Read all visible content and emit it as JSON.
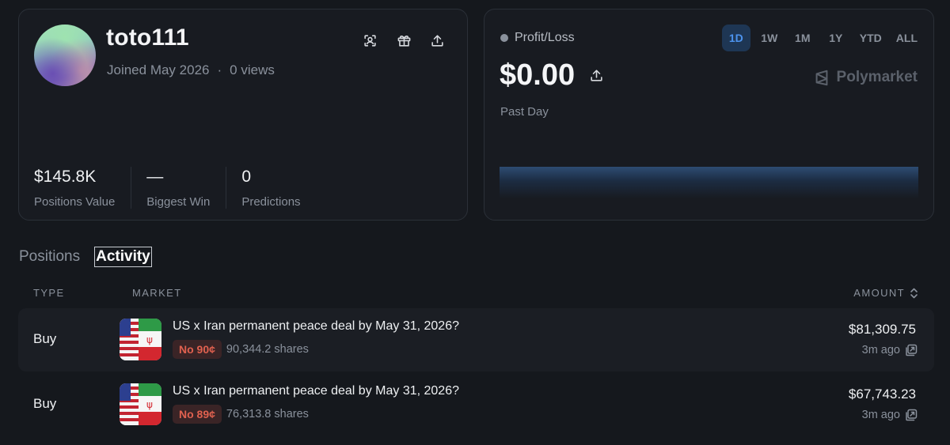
{
  "profile": {
    "username": "toto111",
    "joined": "Joined May 2026",
    "separator": "·",
    "views": "0 views",
    "icons": [
      "profile-scan-icon",
      "gift-icon",
      "share-upload-icon"
    ],
    "stats": [
      {
        "value": "$145.8K",
        "label": "Positions Value"
      },
      {
        "value": "—",
        "label": "Biggest Win"
      },
      {
        "value": "0",
        "label": "Predictions"
      }
    ]
  },
  "pnl": {
    "title": "Profit/Loss",
    "ranges": [
      "1D",
      "1W",
      "1M",
      "1Y",
      "YTD",
      "ALL"
    ],
    "active_range": "1D",
    "value": "$0.00",
    "period": "Past Day",
    "brand": "Polymarket",
    "colors": {
      "active_bg": "#1e3654",
      "active_text": "#4c93ee",
      "chart_fill": "#2e4c72"
    }
  },
  "tabs": {
    "positions": "Positions",
    "activity": "Activity",
    "active": "Activity"
  },
  "table": {
    "headers": {
      "type": "TYPE",
      "market": "MARKET",
      "amount": "AMOUNT"
    },
    "rows": [
      {
        "type": "Buy",
        "market": "US x Iran permanent peace deal by May 31, 2026?",
        "outcome": "No 90¢",
        "shares": "90,344.2 shares",
        "amount": "$81,309.75",
        "time": "3m ago"
      },
      {
        "type": "Buy",
        "market": "US x Iran permanent peace deal by May 31, 2026?",
        "outcome": "No 89¢",
        "shares": "76,313.8 shares",
        "amount": "$67,743.23",
        "time": "3m ago"
      }
    ],
    "colors": {
      "no_pill_bg": "#3a2426",
      "no_pill_text": "#e0614f"
    }
  }
}
